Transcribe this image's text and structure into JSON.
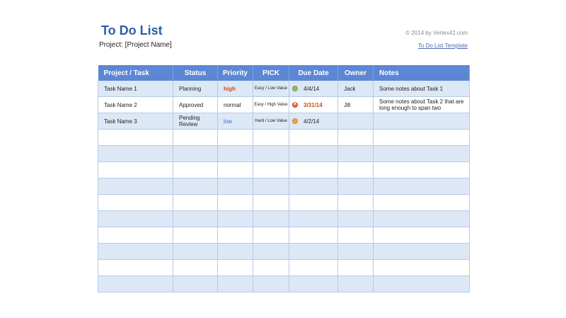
{
  "header": {
    "title": "To Do List",
    "project": "Project: [Project Name]",
    "copyright": "© 2014 by Vertex42.com",
    "template_link": "To Do List Template"
  },
  "table": {
    "columns": [
      "Project / Task",
      "Status",
      "Priority",
      "PICK",
      "Due Date",
      "Owner",
      "Notes"
    ],
    "rows": [
      {
        "task": "Task Name 1",
        "status": "Planning",
        "priority": "high",
        "pick": "Easy / Low Value",
        "due_icon": "green-circle-icon",
        "due": "4/4/14",
        "owner": "Jack",
        "notes": "Some notes about Task 1"
      },
      {
        "task": "Task Name 2",
        "status": "Approved",
        "priority": "normal",
        "pick": "Easy / High Value",
        "due_icon": "overdue-x-icon",
        "due": "3/31/14",
        "owner": "Jill",
        "notes": "Some notes about Task 2 that are long enough to span two"
      },
      {
        "task": "Task Name 3",
        "status": "Pending Review",
        "priority": "low",
        "pick": "Hard / Low Value",
        "due_icon": "orange-circle-icon",
        "due": "4/2/14",
        "owner": "",
        "notes": ""
      }
    ],
    "empty_rows": 10
  },
  "colors": {
    "title": "#2e5fa8",
    "header_bg": "#5b87d4",
    "stripe": "#dde8f6",
    "priority_high": "#c0501f",
    "priority_low": "#3a6ec8"
  }
}
